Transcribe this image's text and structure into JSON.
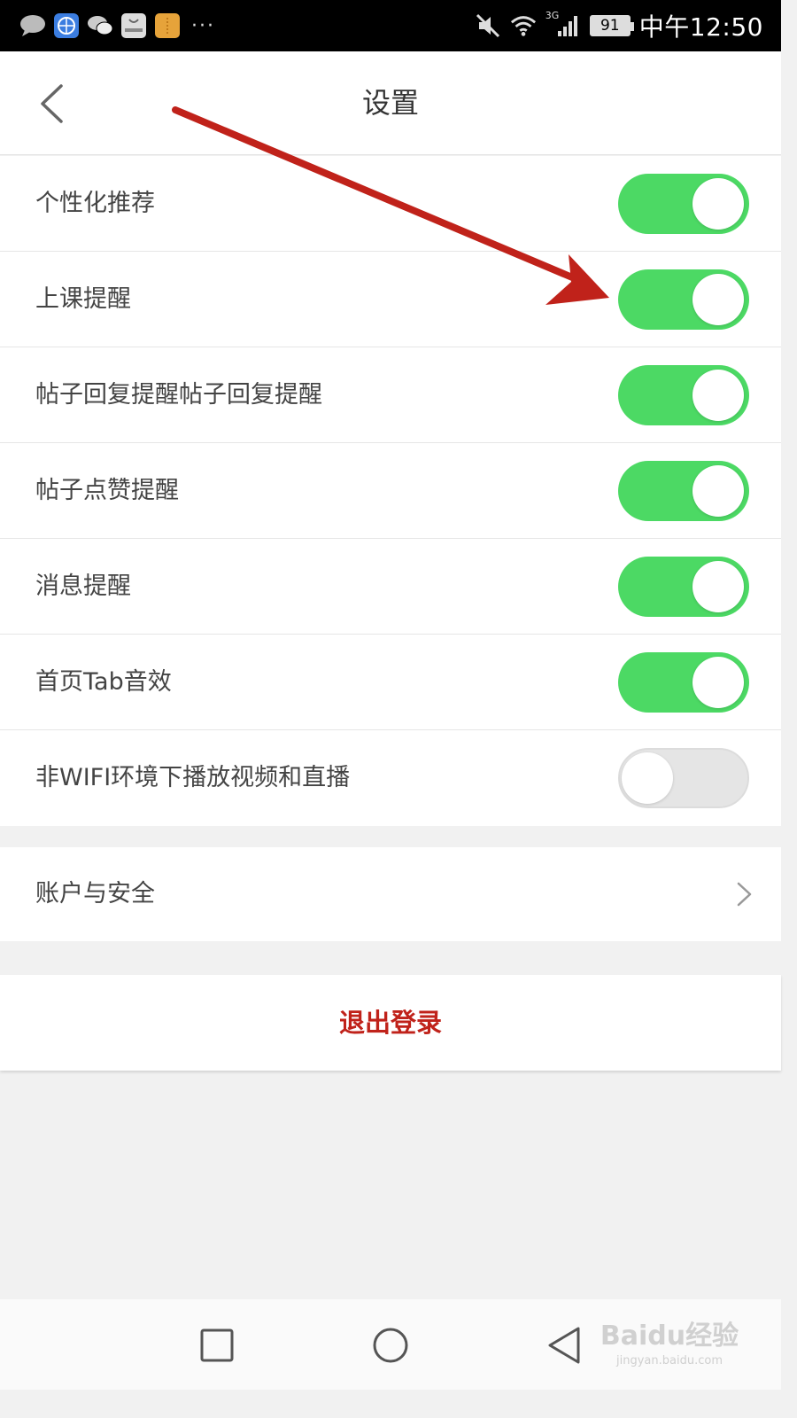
{
  "status_bar": {
    "time": "中午12:50",
    "battery": "91",
    "network": "3G",
    "more": "···"
  },
  "header": {
    "title": "设置"
  },
  "settings": [
    {
      "label": "个性化推荐",
      "enabled": true
    },
    {
      "label": "上课提醒",
      "enabled": true
    },
    {
      "label": "帖子回复提醒帖子回复提醒",
      "enabled": true
    },
    {
      "label": "帖子点赞提醒",
      "enabled": true
    },
    {
      "label": "消息提醒",
      "enabled": true
    },
    {
      "label": "首页Tab音效",
      "enabled": true
    },
    {
      "label": "非WIFI环境下播放视频和直播",
      "enabled": false
    }
  ],
  "account": {
    "label": "账户与安全"
  },
  "logout": {
    "label": "退出登录"
  },
  "watermark": {
    "logo": "Baidu经验",
    "url": "jingyan.baidu.com"
  },
  "colors": {
    "toggle_on": "#4cd964",
    "toggle_off": "#e5e5e5",
    "logout": "#c0221a",
    "arrow": "#c0221a"
  },
  "icons": [
    "back-chevron-icon",
    "chevron-right-icon",
    "recent-apps-icon",
    "home-icon",
    "back-icon"
  ]
}
